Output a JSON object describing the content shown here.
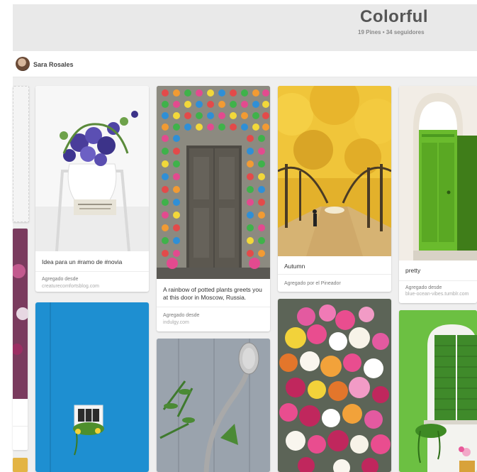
{
  "board": {
    "title": "Colorful",
    "stats": "19 Pines  •  34 seguidores",
    "owner": "Sara Rosales"
  },
  "pins": [
    {
      "description": "Idea para un #ramo de #novia",
      "via_label": "Agregado desde",
      "via_source": "creaturecomfortsblog.com",
      "image": "blue-flower-bouquet-white-chair"
    },
    {
      "description": "A rainbow of potted plants greets you at this door in Moscow, Russia.",
      "via_label": "Agregado desde",
      "via_source": "indulgy.com",
      "image": "colorful-pots-wooden-door"
    },
    {
      "description": "Autumn",
      "via_label": "Agregado por el Pineador",
      "image": "yellow-ginkgo-avenue"
    },
    {
      "description": "pretty",
      "via_label": "Agregado desde",
      "via_source": "blue-ocean-vibes.tumblr.com",
      "image": "green-moroccan-door"
    },
    {
      "image": "blue-wall-flower-window"
    },
    {
      "image": "spoon-and-plant"
    },
    {
      "image": "colorful-flowers-bouquet"
    },
    {
      "image": "green-shutter-window"
    }
  ],
  "colors": {
    "header_bg": "#e9e9e9",
    "grid_bg": "#efefef",
    "title": "#555555"
  }
}
